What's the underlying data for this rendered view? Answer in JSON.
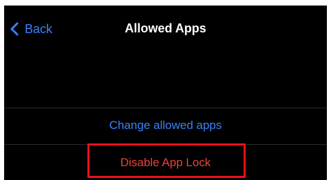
{
  "nav": {
    "back_label": "Back",
    "title": "Allowed Apps"
  },
  "rows": {
    "change_allowed_apps": "Change allowed apps",
    "disable_app_lock": "Disable App Lock"
  },
  "colors": {
    "background": "#000000",
    "link_blue": "#3a82f7",
    "destructive_red": "#e8453c",
    "highlight_box": "#e8101b"
  },
  "icons": {
    "back": "chevron-left-icon"
  }
}
